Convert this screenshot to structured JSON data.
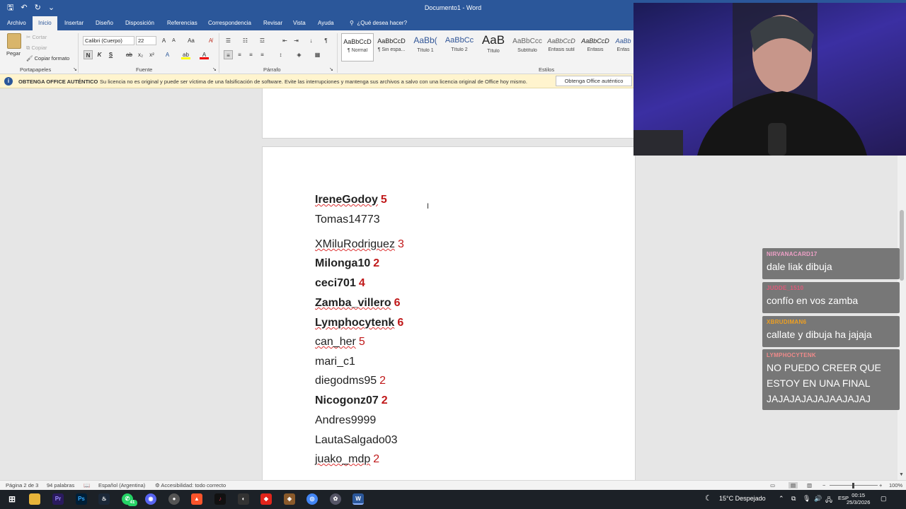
{
  "window": {
    "title": "Documento1 - Word",
    "quick_access": {
      "save_icon": "save-icon",
      "undo_icon": "undo-icon",
      "redo_icon": "redo-icon",
      "customize": "⌄"
    }
  },
  "tabs": [
    "Archivo",
    "Inicio",
    "Insertar",
    "Diseño",
    "Disposición",
    "Referencias",
    "Correspondencia",
    "Revisar",
    "Vista",
    "Ayuda"
  ],
  "tell_me": "¿Qué desea hacer?",
  "ribbon": {
    "clipboard": {
      "paste": "Pegar",
      "cut": "Cortar",
      "copy": "Copiar",
      "format_painter": "Copiar formato",
      "label": "Portapapeles"
    },
    "font": {
      "family": "Calibri (Cuerpo)",
      "size": "22",
      "bold": "N",
      "italic": "K",
      "underline": "S",
      "label": "Fuente"
    },
    "paragraph": {
      "label": "Párrafo"
    },
    "styles": {
      "label": "Estilos",
      "items": [
        {
          "sample": "AaBbCcD",
          "name": "¶ Normal"
        },
        {
          "sample": "AaBbCcD",
          "name": "¶ Sin espa..."
        },
        {
          "sample": "AaBb(",
          "name": "Título 1"
        },
        {
          "sample": "AaBbCc",
          "name": "Título 2"
        },
        {
          "sample": "AaB",
          "name": "Título"
        },
        {
          "sample": "AaBbCcc",
          "name": "Subtítulo"
        },
        {
          "sample": "AaBbCcD",
          "name": "Énfasis sutil"
        },
        {
          "sample": "AaBbCcD",
          "name": "Énfasis"
        },
        {
          "sample": "AaBb",
          "name": "Énfas"
        }
      ]
    }
  },
  "warning": {
    "title": "OBTENGA OFFICE AUTÉNTICO",
    "message": "Su licencia no es original y puede ser víctima de una falsificación de software. Evite las interrupciones y mantenga sus archivos a salvo con una licencia original de Office hoy mismo.",
    "button": "Obtenga Office auténtico"
  },
  "document": {
    "lines": [
      {
        "name": "IreneGodoy",
        "num": "5",
        "bold": true,
        "wavy": true
      },
      {
        "name": "Tomas14773",
        "num": "",
        "bold": false,
        "wavy": false
      },
      {
        "name": "XMiluRodriguez",
        "num": "3",
        "bold": false,
        "wavy": true
      },
      {
        "name": "Milonga10",
        "num": "2",
        "bold": true,
        "wavy": false
      },
      {
        "name": "ceci701",
        "num": "4",
        "bold": true,
        "wavy": false
      },
      {
        "name": "Zamba_villero",
        "num": "6",
        "bold": true,
        "wavy": true
      },
      {
        "name": "Lymphocytenk",
        "num": "6",
        "bold": true,
        "wavy": true
      },
      {
        "name": "can_her",
        "num": "5",
        "bold": false,
        "wavy": true
      },
      {
        "name": "mari_c1",
        "num": "",
        "bold": false,
        "wavy": false
      },
      {
        "name": "diegodms95",
        "num": "2",
        "bold": false,
        "wavy": false
      },
      {
        "name": "Nicogonz07",
        "num": "2",
        "bold": true,
        "wavy": false
      },
      {
        "name": "Andres9999",
        "num": "",
        "bold": false,
        "wavy": false
      },
      {
        "name": "LautaSalgado03",
        "num": "",
        "bold": false,
        "wavy": false
      },
      {
        "name": "juako_mdp",
        "num": "2",
        "bold": false,
        "wavy": true
      }
    ]
  },
  "chat": [
    {
      "user": "NIRVANACARD17",
      "color": "#f0a0c8",
      "message": "dale liak dibuja"
    },
    {
      "user": "JUDDE_1510",
      "color": "#e05a7a",
      "message": "confío en vos zamba"
    },
    {
      "user": "XBRUDIMAN6",
      "color": "#f0a020",
      "message": "callate y dibuja ha jajaja"
    },
    {
      "user": "LYMPHOCYTENK",
      "color": "#f08a8a",
      "message": "NO PUEDO CREER QUE ESTOY EN UNA FINAL JAJAJAJAJAJAAJAJAJ"
    }
  ],
  "status": {
    "page": "Página 2 de 3",
    "words": "94 palabras",
    "language": "Español (Argentina)",
    "accessibility": "Accesibilidad: todo correcto",
    "zoom": "100%"
  },
  "taskbar": {
    "weather": "15°C  Despejado",
    "lang": "ESP",
    "time": "00:15",
    "date": "25/3/2026",
    "badge": "41"
  }
}
